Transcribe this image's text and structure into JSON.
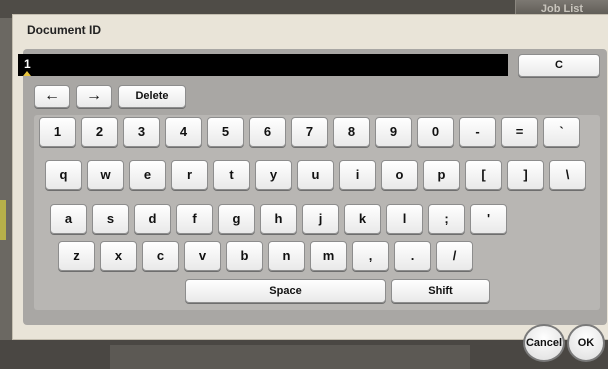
{
  "background": {
    "job_list_label": "Job List"
  },
  "dialog": {
    "title": "Document ID"
  },
  "input": {
    "value": "1"
  },
  "buttons": {
    "clear": "C",
    "left_arrow": "←",
    "right_arrow": "→",
    "delete": "Delete",
    "space": "Space",
    "shift": "Shift",
    "cancel": "Cancel",
    "ok": "OK"
  },
  "keyboard": {
    "row1": [
      "1",
      "2",
      "3",
      "4",
      "5",
      "6",
      "7",
      "8",
      "9",
      "0",
      "-",
      "=",
      "`"
    ],
    "row2": [
      "q",
      "w",
      "e",
      "r",
      "t",
      "y",
      "u",
      "i",
      "o",
      "p",
      "[",
      "]",
      "\\"
    ],
    "row3": [
      "a",
      "s",
      "d",
      "f",
      "g",
      "h",
      "j",
      "k",
      "l",
      ";",
      "'"
    ],
    "row4": [
      "z",
      "x",
      "c",
      "v",
      "b",
      "n",
      "m",
      ",",
      ".",
      "/"
    ]
  },
  "colors": {
    "accent_caret": "#e7c33d",
    "panel": "#a9a7a4",
    "dialog": "#e9e4d8"
  }
}
